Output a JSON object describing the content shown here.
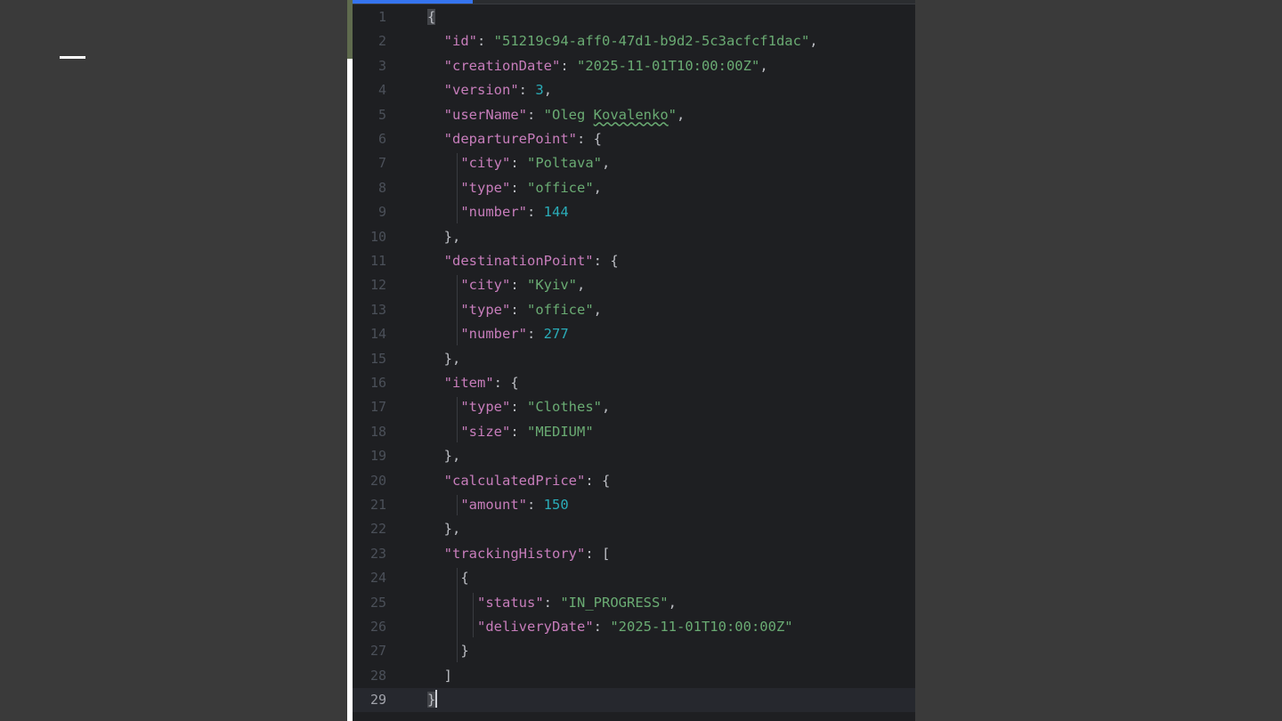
{
  "slide": {
    "background": "#3a3a3a",
    "dash_color": "#ffffff"
  },
  "editor": {
    "background": "#1e1f22",
    "colors": {
      "key": "#c77dbb",
      "string": "#6aab73",
      "number": "#2aacb8",
      "punct": "#bcbec4",
      "line_number": "#4b5059",
      "current_line": "#26282e"
    },
    "current_line": 29,
    "lines": [
      {
        "num": "1",
        "parts": [
          {
            "t": "{",
            "c": "p hl"
          }
        ]
      },
      {
        "num": "2",
        "parts": [
          {
            "t": "  "
          },
          {
            "t": "\"id\"",
            "c": "k"
          },
          {
            "t": ": ",
            "c": "p"
          },
          {
            "t": "\"51219c94-aff0-47d1-b9d2-5c3acfcf1dac\"",
            "c": "s"
          },
          {
            "t": ",",
            "c": "p"
          }
        ]
      },
      {
        "num": "3",
        "parts": [
          {
            "t": "  "
          },
          {
            "t": "\"creationDate\"",
            "c": "k"
          },
          {
            "t": ": ",
            "c": "p"
          },
          {
            "t": "\"2025-11-01T10:00:00Z\"",
            "c": "s"
          },
          {
            "t": ",",
            "c": "p"
          }
        ]
      },
      {
        "num": "4",
        "parts": [
          {
            "t": "  "
          },
          {
            "t": "\"version\"",
            "c": "k"
          },
          {
            "t": ": ",
            "c": "p"
          },
          {
            "t": "3",
            "c": "n"
          },
          {
            "t": ",",
            "c": "p"
          }
        ]
      },
      {
        "num": "5",
        "parts": [
          {
            "t": "  "
          },
          {
            "t": "\"userName\"",
            "c": "k"
          },
          {
            "t": ": ",
            "c": "p"
          },
          {
            "t": "\"Oleg ",
            "c": "s"
          },
          {
            "t": "Kovalenko",
            "c": "s sq"
          },
          {
            "t": "\"",
            "c": "s"
          },
          {
            "t": ",",
            "c": "p"
          }
        ]
      },
      {
        "num": "6",
        "parts": [
          {
            "t": "  "
          },
          {
            "t": "\"departurePoint\"",
            "c": "k"
          },
          {
            "t": ": {",
            "c": "p"
          }
        ]
      },
      {
        "num": "7",
        "parts": [
          {
            "t": "    "
          },
          {
            "t": "\"city\"",
            "c": "k"
          },
          {
            "t": ": ",
            "c": "p"
          },
          {
            "t": "\"Poltava\"",
            "c": "s"
          },
          {
            "t": ",",
            "c": "p"
          }
        ]
      },
      {
        "num": "8",
        "parts": [
          {
            "t": "    "
          },
          {
            "t": "\"type\"",
            "c": "k"
          },
          {
            "t": ": ",
            "c": "p"
          },
          {
            "t": "\"office\"",
            "c": "s"
          },
          {
            "t": ",",
            "c": "p"
          }
        ]
      },
      {
        "num": "9",
        "parts": [
          {
            "t": "    "
          },
          {
            "t": "\"number\"",
            "c": "k"
          },
          {
            "t": ": ",
            "c": "p"
          },
          {
            "t": "144",
            "c": "n"
          }
        ]
      },
      {
        "num": "10",
        "parts": [
          {
            "t": "  "
          },
          {
            "t": "},",
            "c": "p"
          }
        ]
      },
      {
        "num": "11",
        "parts": [
          {
            "t": "  "
          },
          {
            "t": "\"destinationPoint\"",
            "c": "k"
          },
          {
            "t": ": {",
            "c": "p"
          }
        ]
      },
      {
        "num": "12",
        "parts": [
          {
            "t": "    "
          },
          {
            "t": "\"city\"",
            "c": "k"
          },
          {
            "t": ": ",
            "c": "p"
          },
          {
            "t": "\"Kyiv\"",
            "c": "s"
          },
          {
            "t": ",",
            "c": "p"
          }
        ]
      },
      {
        "num": "13",
        "parts": [
          {
            "t": "    "
          },
          {
            "t": "\"type\"",
            "c": "k"
          },
          {
            "t": ": ",
            "c": "p"
          },
          {
            "t": "\"office\"",
            "c": "s"
          },
          {
            "t": ",",
            "c": "p"
          }
        ]
      },
      {
        "num": "14",
        "parts": [
          {
            "t": "    "
          },
          {
            "t": "\"number\"",
            "c": "k"
          },
          {
            "t": ": ",
            "c": "p"
          },
          {
            "t": "277",
            "c": "n"
          }
        ]
      },
      {
        "num": "15",
        "parts": [
          {
            "t": "  "
          },
          {
            "t": "},",
            "c": "p"
          }
        ]
      },
      {
        "num": "16",
        "parts": [
          {
            "t": "  "
          },
          {
            "t": "\"item\"",
            "c": "k"
          },
          {
            "t": ": {",
            "c": "p"
          }
        ]
      },
      {
        "num": "17",
        "parts": [
          {
            "t": "    "
          },
          {
            "t": "\"type\"",
            "c": "k"
          },
          {
            "t": ": ",
            "c": "p"
          },
          {
            "t": "\"Clothes\"",
            "c": "s"
          },
          {
            "t": ",",
            "c": "p"
          }
        ]
      },
      {
        "num": "18",
        "parts": [
          {
            "t": "    "
          },
          {
            "t": "\"size\"",
            "c": "k"
          },
          {
            "t": ": ",
            "c": "p"
          },
          {
            "t": "\"MEDIUM\"",
            "c": "s"
          }
        ]
      },
      {
        "num": "19",
        "parts": [
          {
            "t": "  "
          },
          {
            "t": "},",
            "c": "p"
          }
        ]
      },
      {
        "num": "20",
        "parts": [
          {
            "t": "  "
          },
          {
            "t": "\"calculatedPrice\"",
            "c": "k"
          },
          {
            "t": ": {",
            "c": "p"
          }
        ]
      },
      {
        "num": "21",
        "parts": [
          {
            "t": "    "
          },
          {
            "t": "\"amount\"",
            "c": "k"
          },
          {
            "t": ": ",
            "c": "p"
          },
          {
            "t": "150",
            "c": "n"
          }
        ]
      },
      {
        "num": "22",
        "parts": [
          {
            "t": "  "
          },
          {
            "t": "},",
            "c": "p"
          }
        ]
      },
      {
        "num": "23",
        "parts": [
          {
            "t": "  "
          },
          {
            "t": "\"trackingHistory\"",
            "c": "k"
          },
          {
            "t": ": [",
            "c": "p"
          }
        ]
      },
      {
        "num": "24",
        "parts": [
          {
            "t": "    "
          },
          {
            "t": "{",
            "c": "p"
          }
        ]
      },
      {
        "num": "25",
        "parts": [
          {
            "t": "      "
          },
          {
            "t": "\"status\"",
            "c": "k"
          },
          {
            "t": ": ",
            "c": "p"
          },
          {
            "t": "\"IN_PROGRESS\"",
            "c": "s"
          },
          {
            "t": ",",
            "c": "p"
          }
        ]
      },
      {
        "num": "26",
        "parts": [
          {
            "t": "      "
          },
          {
            "t": "\"deliveryDate\"",
            "c": "k"
          },
          {
            "t": ": ",
            "c": "p"
          },
          {
            "t": "\"2025-11-01T10:00:00Z\"",
            "c": "s"
          }
        ]
      },
      {
        "num": "27",
        "parts": [
          {
            "t": "    "
          },
          {
            "t": "}",
            "c": "p"
          }
        ]
      },
      {
        "num": "28",
        "parts": [
          {
            "t": "  "
          },
          {
            "t": "]",
            "c": "p"
          }
        ]
      },
      {
        "num": "29",
        "parts": [
          {
            "t": "}",
            "c": "p hl"
          },
          {
            "t": "",
            "c": "caret"
          }
        ]
      }
    ]
  }
}
